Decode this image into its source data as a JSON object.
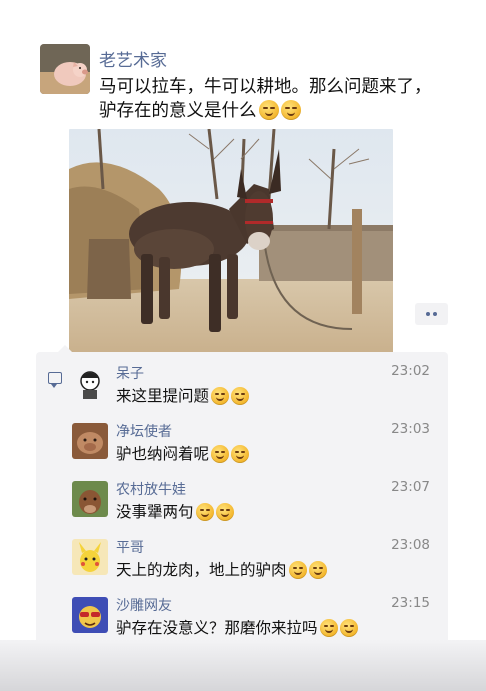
{
  "post": {
    "author": "老艺术家",
    "text": "马可以拉车，牛可以耕地。那么问题来了，驴存在的意义是什么",
    "emojis": [
      "smirk-emoji",
      "smirk-emoji"
    ]
  },
  "comments": [
    {
      "name": "呆子",
      "time": "23:02",
      "text": "来这里提问题",
      "avatar": "cartoon-avatar",
      "emojis": [
        "grimace-emoji",
        "grimace-emoji"
      ]
    },
    {
      "name": "净坛使者",
      "time": "23:03",
      "text": "驴也纳闷着呢",
      "avatar": "pig-avatar",
      "emojis": [
        "laugh-emoji",
        "laugh-emoji"
      ]
    },
    {
      "name": "农村放牛娃",
      "time": "23:07",
      "text": "没事犟两句",
      "avatar": "cow-avatar",
      "emojis": [
        "grin-emoji",
        "grin-emoji"
      ]
    },
    {
      "name": "平哥",
      "time": "23:08",
      "text": "天上的龙肉，地上的驴肉",
      "avatar": "pikachu-avatar",
      "emojis": [
        "drool-emoji",
        "drool-emoji"
      ]
    },
    {
      "name": "沙雕网友",
      "time": "23:15",
      "text": "驴存在没意义？那磨你来拉吗",
      "avatar": "sunglasses-avatar",
      "emojis": [
        "smile-emoji",
        "smile-emoji"
      ]
    }
  ],
  "colors": {
    "name_blue": "#576b95",
    "comment_bg": "#f3f3f5",
    "timestamp_gray": "#888888"
  }
}
